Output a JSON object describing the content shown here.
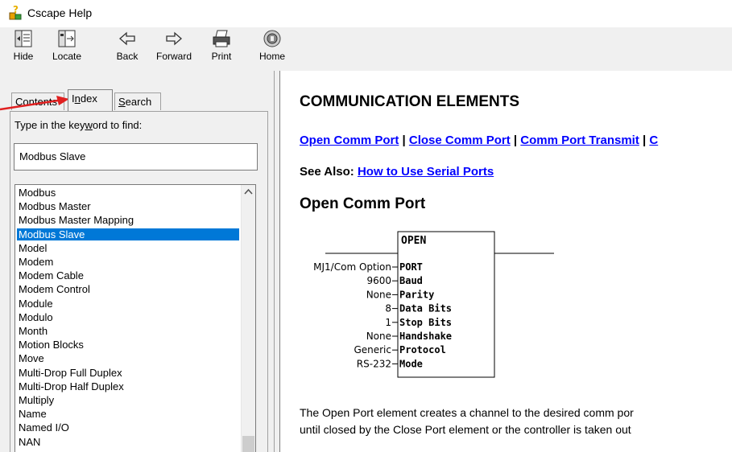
{
  "window": {
    "title": "Cscape Help"
  },
  "toolbar": {
    "hide": "Hide",
    "locate": "Locate",
    "back": "Back",
    "forward": "Forward",
    "print": "Print",
    "home": "Home"
  },
  "tabs": {
    "contents_pre": "",
    "contents_u": "C",
    "contents_post": "ontents",
    "index_pre": "I",
    "index_u": "n",
    "index_post": "dex",
    "search_pre": "",
    "search_u": "S",
    "search_post": "earch"
  },
  "index": {
    "prompt_pre": "Type in the key",
    "prompt_u": "w",
    "prompt_post": "ord to find:",
    "search_value": "Modbus Slave",
    "items": [
      "Modbus",
      "Modbus Master",
      "Modbus Master Mapping",
      "Modbus Slave",
      "Model",
      "Modem",
      "Modem Cable",
      "Modem Control",
      "Module",
      "Modulo",
      "Month",
      "Motion Blocks",
      "Move",
      "Multi-Drop Full Duplex",
      "Multi-Drop Half Duplex",
      "Multiply",
      "Name",
      "Named I/O",
      "NAN"
    ],
    "selected_index": 3
  },
  "content": {
    "heading": "COMMUNICATION ELEMENTS",
    "links": {
      "open": "Open Comm Port",
      "close": "Close Comm Port",
      "transmit": "Comm  Port Transmit",
      "more": "C",
      "sep": " | "
    },
    "see_also_label": "See Also: ",
    "see_also_link": "How to Use Serial Ports",
    "subheading": "Open Comm Port",
    "block": {
      "name": "OPEN",
      "params": [
        {
          "value": "MJ1/Com Option",
          "label": "PORT"
        },
        {
          "value": "9600",
          "label": "Baud"
        },
        {
          "value": "None",
          "label": "Parity"
        },
        {
          "value": "8",
          "label": "Data Bits"
        },
        {
          "value": "1",
          "label": "Stop Bits"
        },
        {
          "value": "None",
          "label": "Handshake"
        },
        {
          "value": "Generic",
          "label": "Protocol"
        },
        {
          "value": "RS-232",
          "label": "Mode"
        }
      ]
    },
    "paragraph_line1": "The Open Port element creates a channel to the desired comm por",
    "paragraph_line2": "until closed by the Close Port element or the controller is taken out"
  },
  "colors": {
    "selection": "#0078d7",
    "link": "#0000ff",
    "annotation_arrow": "#e02020"
  }
}
